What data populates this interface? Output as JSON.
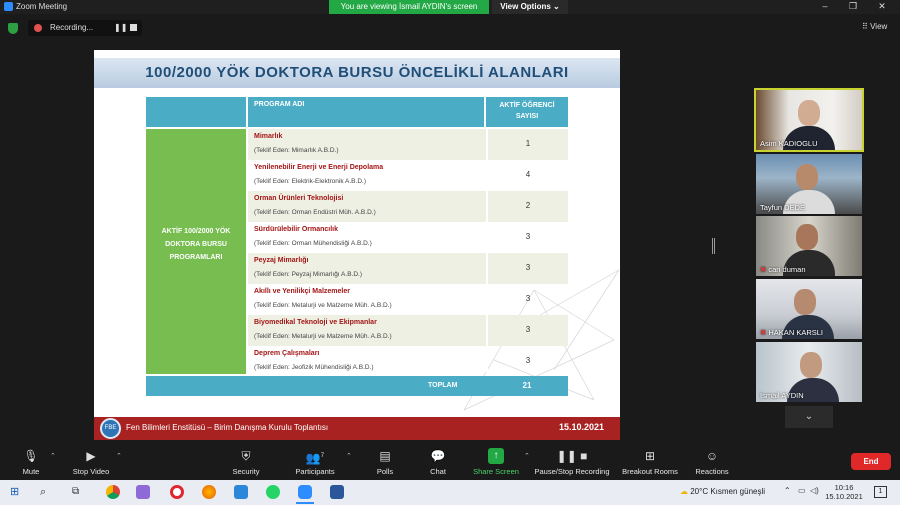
{
  "window": {
    "title": "Zoom Meeting",
    "viewing_banner": "You are viewing İsmail AYDIN's screen",
    "view_options": "View Options ⌄",
    "view_button": "View",
    "recording_label": "Recording..."
  },
  "slide": {
    "title": "100/2000 YÖK DOKTORA BURSU ÖNCELİKLİ ALANLARI",
    "col_program": "PROGRAM ADI",
    "col_count": "AKTİF ÖĞRENCİ SAYISI",
    "left_label": "AKTİF 100/2000 YÖK DOKTORA BURSU PROGRAMLARI",
    "rows": [
      {
        "name": "Mimarlık",
        "sub": "(Teklif Eden: Mimarlık A.B.D.)",
        "count": "1"
      },
      {
        "name": "Yenilenebilir Enerji ve Enerji Depolama",
        "sub": "(Teklif Eden: Elektrik-Elektronik A.B.D.)",
        "count": "4"
      },
      {
        "name": "Orman Ürünleri Teknolojisi",
        "sub": "(Teklif Eden: Orman Endüstri Müh. A.B.D.)",
        "count": "2"
      },
      {
        "name": "Sürdürülebilir Ormancılık",
        "sub": "(Teklif Eden: Orman Mühendisliği A.B.D.)",
        "count": "3"
      },
      {
        "name": "Peyzaj Mimarlığı",
        "sub": "(Teklif Eden: Peyzaj Mimarlığı A.B.D.)",
        "count": "3"
      },
      {
        "name": "Akıllı ve Yenilikçi Malzemeler",
        "sub": "(Teklif Eden: Metalurji ve Malzeme Müh. A.B.D.)",
        "count": "3"
      },
      {
        "name": "Biyomedikal Teknoloji ve Ekipmanlar",
        "sub": "(Teklif Eden: Metalurji ve Malzeme Müh. A.B.D.)",
        "count": "3"
      },
      {
        "name": "Deprem Çalışmaları",
        "sub": "(Teklif Eden: Jeofizik Mühendisliği A.B.D.)",
        "count": "3"
      }
    ],
    "total_label": "TOPLAM",
    "total_value": "21",
    "footer_text": "Fen Bilimleri Enstitüsü – Birim Danışma Kurulu Toplantısı",
    "footer_date": "15.10.2021"
  },
  "participants": [
    {
      "name": "Asim KADIOGLU",
      "muted": false
    },
    {
      "name": "Tayfun DEDE",
      "muted": false
    },
    {
      "name": "cari duman",
      "muted": true
    },
    {
      "name": "HAKAN KARSLI",
      "muted": true
    },
    {
      "name": "İsmail AYDIN",
      "muted": false
    }
  ],
  "toolbar": {
    "mute": "Mute",
    "stop_video": "Stop Video",
    "security": "Security",
    "participants": "Participants",
    "participants_count": "7",
    "polls": "Polls",
    "chat": "Chat",
    "share_screen": "Share Screen",
    "pause_recording": "Pause/Stop Recording",
    "breakout": "Breakout Rooms",
    "reactions": "Reactions",
    "end": "End"
  },
  "taskbar": {
    "weather": "20°C  Kısmen güneşli",
    "time": "10:16",
    "date": "15.10.2021",
    "notification_count": "1"
  },
  "colors": {
    "share_green": "#22a845",
    "table_header": "#4bacc6",
    "left_cell": "#77bd4f",
    "footer_red": "#a82222",
    "end_red": "#e02828"
  }
}
